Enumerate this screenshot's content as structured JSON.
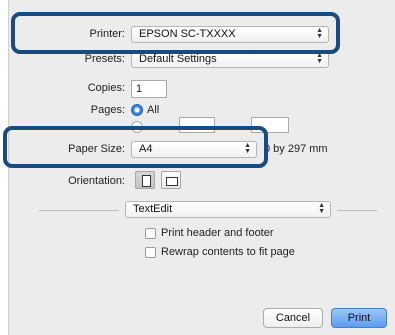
{
  "printer": {
    "label": "Printer:",
    "value": "EPSON SC-TXXXX"
  },
  "presets": {
    "label": "Presets:",
    "value": "Default Settings"
  },
  "copies": {
    "label": "Copies:",
    "value": "1"
  },
  "pages": {
    "label": "Pages:",
    "all_label": "All"
  },
  "paper_size": {
    "label": "Paper Size:",
    "value": "A4",
    "dimensions": "0 by 297 mm"
  },
  "orientation": {
    "label": "Orientation:"
  },
  "app_menu": {
    "value": "TextEdit"
  },
  "options": {
    "print_header_footer": "Print header and footer",
    "rewrap_contents": "Rewrap contents to fit page"
  },
  "buttons": {
    "cancel": "Cancel",
    "print": "Print"
  },
  "colors": {
    "highlight": "#1a4b80",
    "accent": "#3d8ef0",
    "dialog_bg": "#ececec"
  }
}
